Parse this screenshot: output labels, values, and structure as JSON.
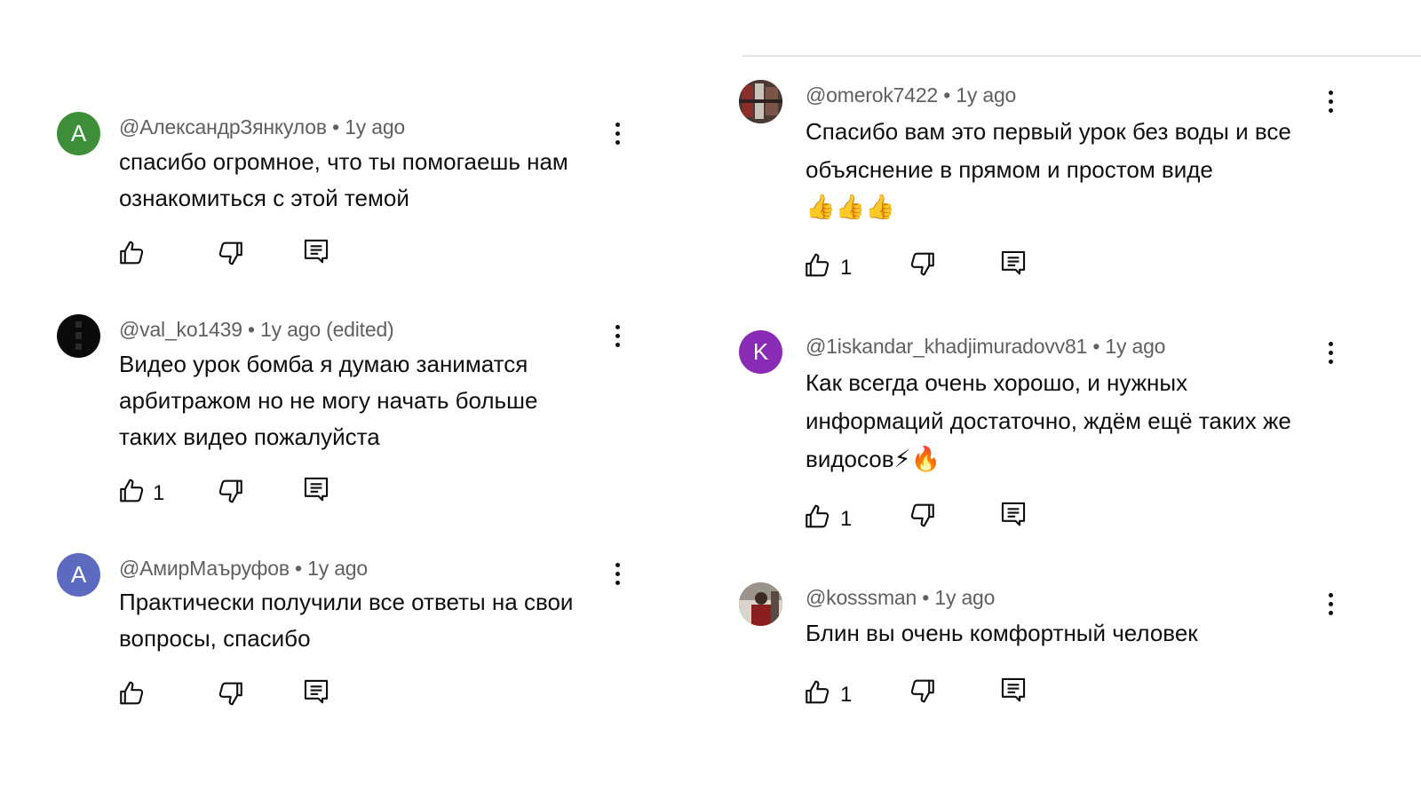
{
  "colors": {
    "avatar_green": "#3f8f3a",
    "avatar_purple": "#8a2bb5",
    "avatar_blue": "#5c6bc0",
    "avatar_black": "#0a0a0a",
    "meta_gray": "#606060"
  },
  "left_comments": [
    {
      "avatar_letter": "A",
      "author": "@АлександрЗянкулов",
      "time": "1y ago",
      "text": "спасибо огромное, что ты помогаешь нам ознакомиться с этой темой",
      "likes": ""
    },
    {
      "avatar_letter": "",
      "author": "@val_ko1439",
      "time": "1y ago (edited)",
      "text": "Видео урок бомба я думаю заниматся арбитражом но не могу начать больше таких видео пожалуйста",
      "likes": "1"
    },
    {
      "avatar_letter": "A",
      "author": "@АмирМаъруфов",
      "time": "1y ago",
      "text": "Практически получили все ответы на свои вопросы, спасибо",
      "likes": ""
    }
  ],
  "right_comments": [
    {
      "avatar_letter": "",
      "author": "@omerok7422",
      "time": "1y ago",
      "text": "Спасибо вам это первый урок без воды и все объяснение в прямом и простом виде",
      "emoji": "👍👍👍",
      "likes": "1"
    },
    {
      "avatar_letter": "K",
      "author": "@1iskandar_khadjimuradovv81",
      "time": "1y ago",
      "text": "Как всегда очень хорошо, и нужных информаций достаточно, ждём ещё таких же видосов",
      "emoji": "⚡🔥",
      "likes": "1"
    },
    {
      "avatar_letter": "",
      "author": "@kosssman",
      "time": "1y ago",
      "text": "Блин вы очень комфортный человек",
      "emoji": "",
      "likes": "1"
    }
  ],
  "separator": "•",
  "icons": {
    "like": "thumbs-up-icon",
    "dislike": "thumbs-down-icon",
    "reply": "reply-icon",
    "menu": "more-vert-icon"
  }
}
